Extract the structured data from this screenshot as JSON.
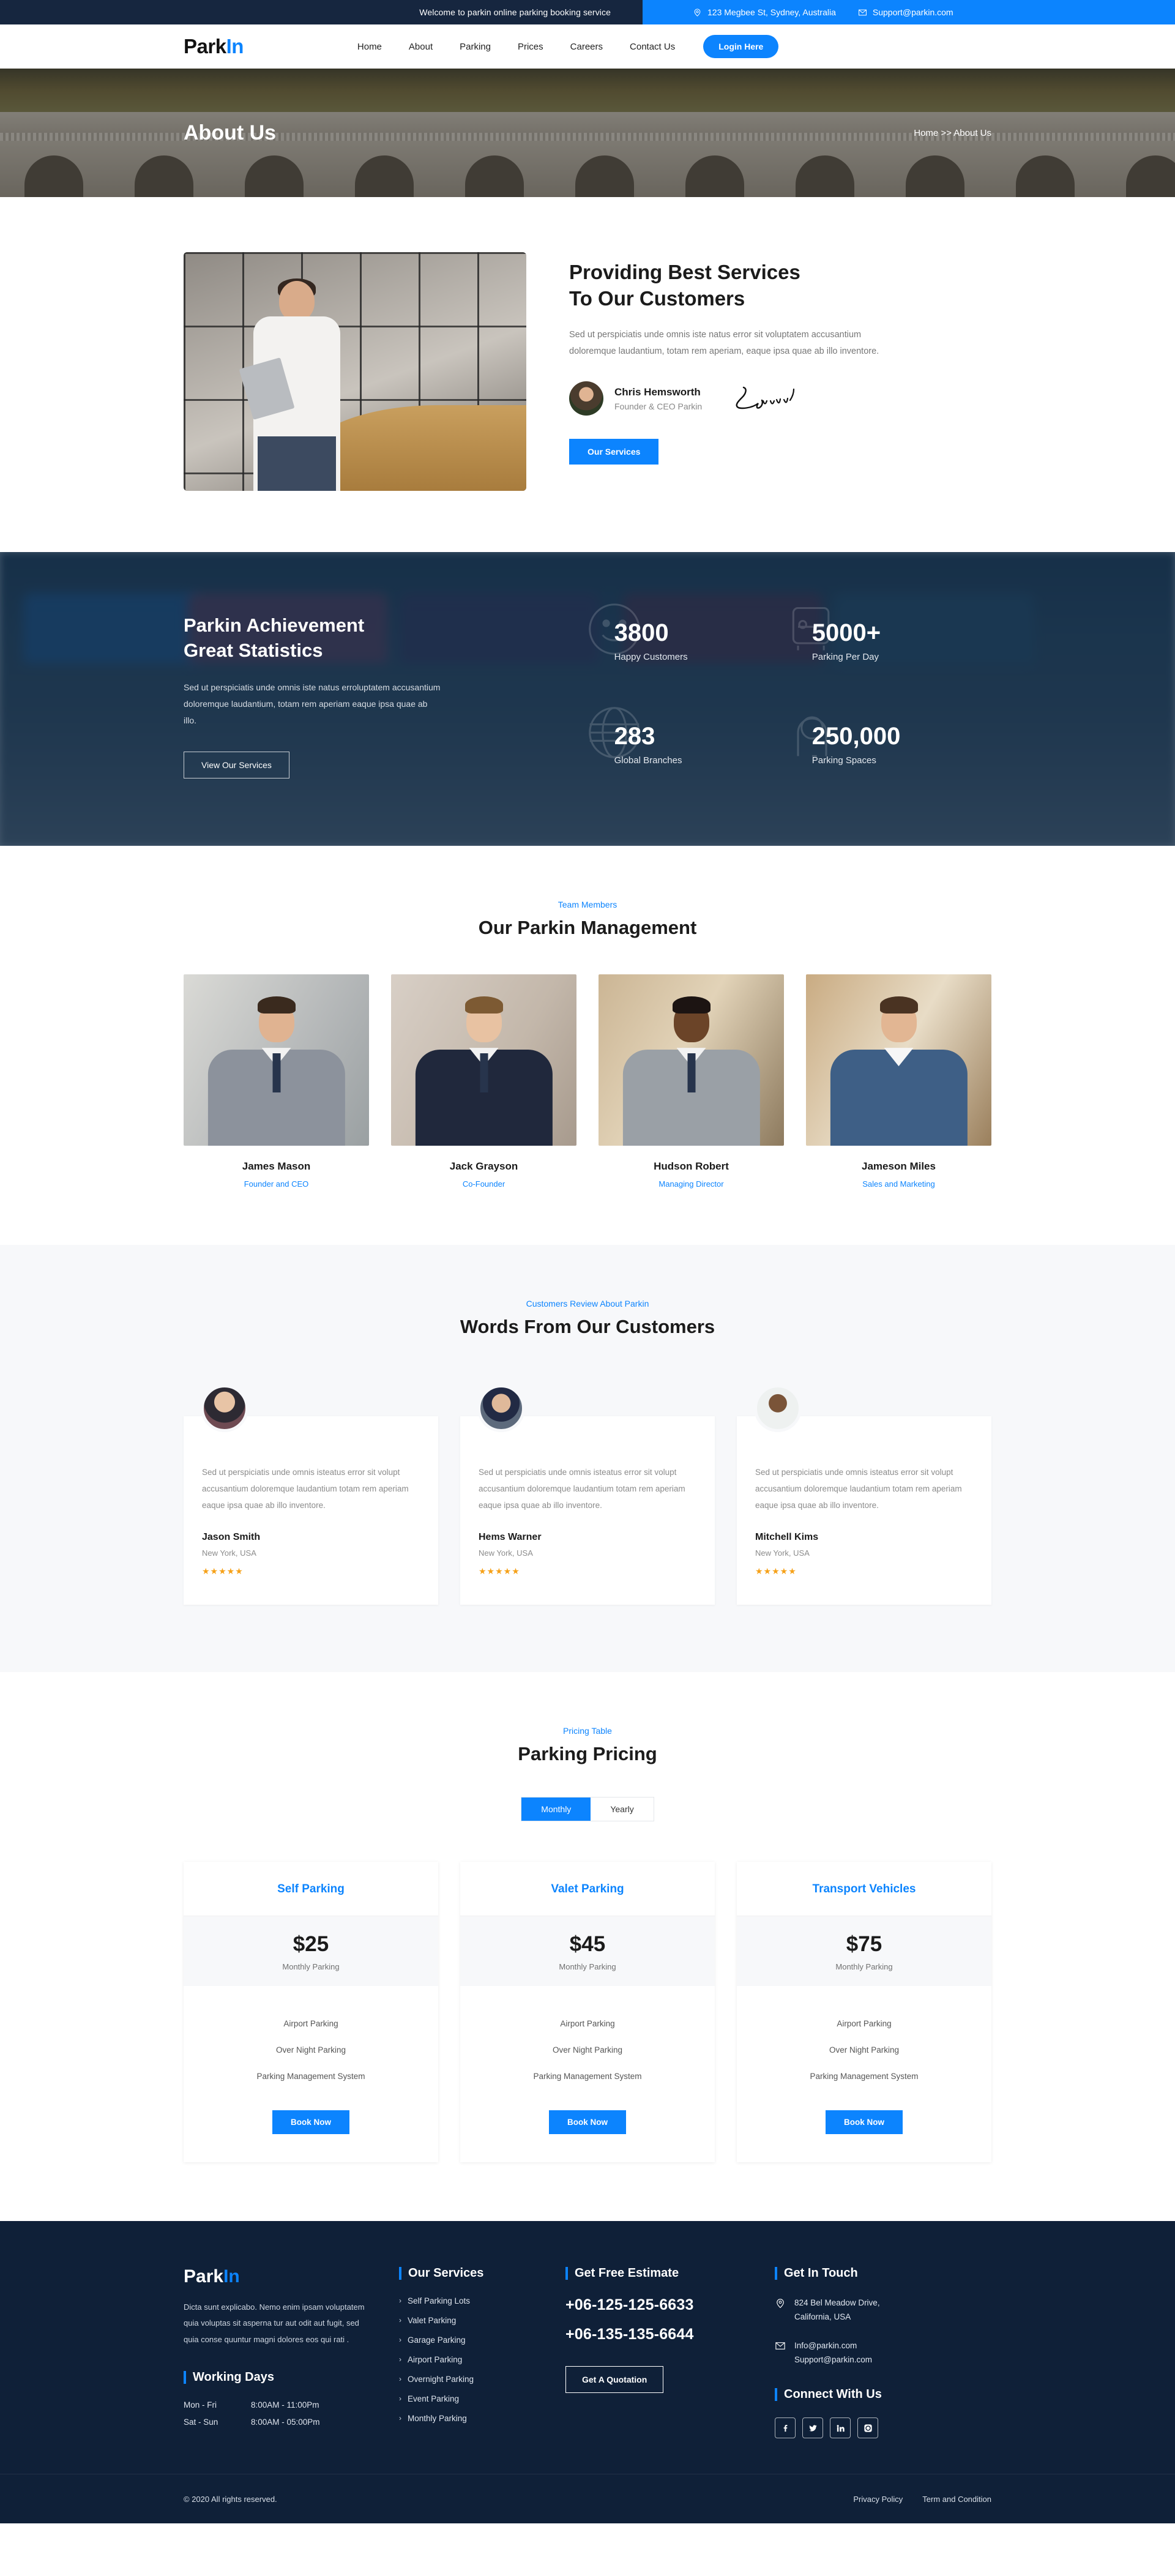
{
  "topbar": {
    "welcome": "Welcome to parkin online parking booking service",
    "address": "123 Megbee St, Sydney, Australia",
    "email": "Support@parkin.com"
  },
  "nav": {
    "logo_dark": "Park",
    "logo_blue": "In",
    "links": [
      "Home",
      "About",
      "Parking",
      "Prices",
      "Careers",
      "Contact Us"
    ],
    "login_label": "Login Here"
  },
  "banner": {
    "title": "About Us",
    "breadcrumb": "Home >> About Us"
  },
  "about": {
    "heading_line1": "Providing Best Services",
    "heading_line2": "To Our Customers",
    "paragraph": "Sed ut perspiciatis unde omnis iste natus error sit voluptatem accusantium doloremque laudantium, totam rem aperiam, eaque ipsa quae ab illo inventore.",
    "author_name": "Chris Hemsworth",
    "author_role": "Founder & CEO Parkin",
    "cta": "Our Services"
  },
  "stats": {
    "heading_line1": "Parkin Achievement",
    "heading_line2": "Great Statistics",
    "paragraph": "Sed ut perspiciatis unde omnis iste natus erroluptatem accusantium doloremque laudantium, totam rem aperiam eaque ipsa quae ab illo.",
    "cta": "View Our Services",
    "items": [
      {
        "value": "3800",
        "label": "Happy Customers",
        "icon": "smiley-icon"
      },
      {
        "value": "5000+",
        "label": "Parking Per Day",
        "icon": "car-icon"
      },
      {
        "value": "283",
        "label": "Global Branches",
        "icon": "globe-icon"
      },
      {
        "value": "250,000",
        "label": "Parking Spaces",
        "icon": "parking-meter-icon"
      }
    ]
  },
  "team": {
    "eyebrow": "Team Members",
    "title": "Our Parkin Management",
    "members": [
      {
        "name": "James Mason",
        "role": "Founder and CEO",
        "suit": "#8c929c",
        "hair": "#3a2a1e",
        "skin": "#e0b391",
        "bg": "#c9cbcb"
      },
      {
        "name": "Jack Grayson",
        "role": "Co-Founder",
        "suit": "#20283c",
        "hair": "#7d5a33",
        "skin": "#e8c2a2",
        "bg": "#cdc2b8"
      },
      {
        "name": "Hudson Robert",
        "role": "Managing Director",
        "suit": "#9aa0a6",
        "hair": "#1c1412",
        "skin": "#6b4428",
        "bg": "#b49a74"
      },
      {
        "name": "Jameson Miles",
        "role": "Sales and Marketing",
        "suit": "#3e5f86",
        "hair": "#4a3322",
        "skin": "#e2b693",
        "bg": "#b99d7e"
      }
    ]
  },
  "reviews": {
    "eyebrow": "Customers Review About Parkin",
    "title": "Words From Our Customers",
    "stars": "★★★★★",
    "items": [
      {
        "text": "Sed ut perspiciatis unde omnis isteatus error sit volupt accusantium doloremque laudantium totam rem aperiam eaque ipsa quae ab illo inventore.",
        "name": "Jason Smith",
        "location": "New York, USA"
      },
      {
        "text": "Sed ut perspiciatis unde omnis isteatus error sit volupt accusantium doloremque laudantium totam rem aperiam eaque ipsa quae ab illo inventore.",
        "name": "Hems Warner",
        "location": "New York, USA"
      },
      {
        "text": "Sed ut perspiciatis unde omnis isteatus error sit volupt accusantium doloremque laudantium totam rem aperiam eaque ipsa quae ab illo inventore.",
        "name": "Mitchell Kims",
        "location": "New York, USA"
      }
    ]
  },
  "pricing": {
    "eyebrow": "Pricing Table",
    "title": "Parking Pricing",
    "toggle_monthly": "Monthly",
    "toggle_yearly": "Yearly",
    "plans": [
      {
        "name": "Self Parking",
        "amount": "$25",
        "period": "Monthly Parking",
        "features": [
          "Airport Parking",
          "Over Night Parking",
          "Parking Management System"
        ],
        "cta": "Book Now"
      },
      {
        "name": "Valet Parking",
        "amount": "$45",
        "period": "Monthly Parking",
        "features": [
          "Airport Parking",
          "Over Night Parking",
          "Parking Management System"
        ],
        "cta": "Book Now"
      },
      {
        "name": "Transport Vehicles",
        "amount": "$75",
        "period": "Monthly Parking",
        "features": [
          "Airport Parking",
          "Over Night Parking",
          "Parking Management System"
        ],
        "cta": "Book Now"
      }
    ]
  },
  "footer": {
    "logo_dark": "Park",
    "logo_blue": "In",
    "description": "Dicta sunt explicabo. Nemo enim ipsam voluptatem quia voluptas sit asperna tur aut odit aut fugit, sed quia conse quuntur magni dolores eos qui rati .",
    "working_days_title": "Working Days",
    "working_days": [
      {
        "days": "Mon - Fri",
        "hours": "8:00AM - 11:00Pm"
      },
      {
        "days": "Sat - Sun",
        "hours": "8:00AM - 05:00Pm"
      }
    ],
    "services_title": "Our Services",
    "services": [
      "Self Parking Lots",
      "Valet Parking",
      "Garage Parking",
      "Airport Parking",
      "Overnight Parking",
      "Event Parking",
      "Monthly Parking"
    ],
    "estimate_title": "Get Free Estimate",
    "phone1": "+06-125-125-6633",
    "phone2": "+06-135-135-6644",
    "quote_cta": "Get A Quotation",
    "touch_title": "Get In Touch",
    "address_line1": "824 Bel Meadow Drive,",
    "address_line2": "California, USA",
    "email1": "Info@parkin.com",
    "email2": "Support@parkin.com",
    "connect_title": "Connect With Us",
    "socials": [
      "facebook-icon",
      "twitter-icon",
      "linkedin-icon",
      "instagram-icon"
    ],
    "copyright": "© 2020 All rights reserved.",
    "legal": [
      "Privacy Policy",
      "Term and Condition"
    ]
  },
  "colors": {
    "accent": "#0c84fe",
    "dark_navy": "#0f2038",
    "topbar_dark": "#16263f",
    "star": "#f6a118"
  }
}
